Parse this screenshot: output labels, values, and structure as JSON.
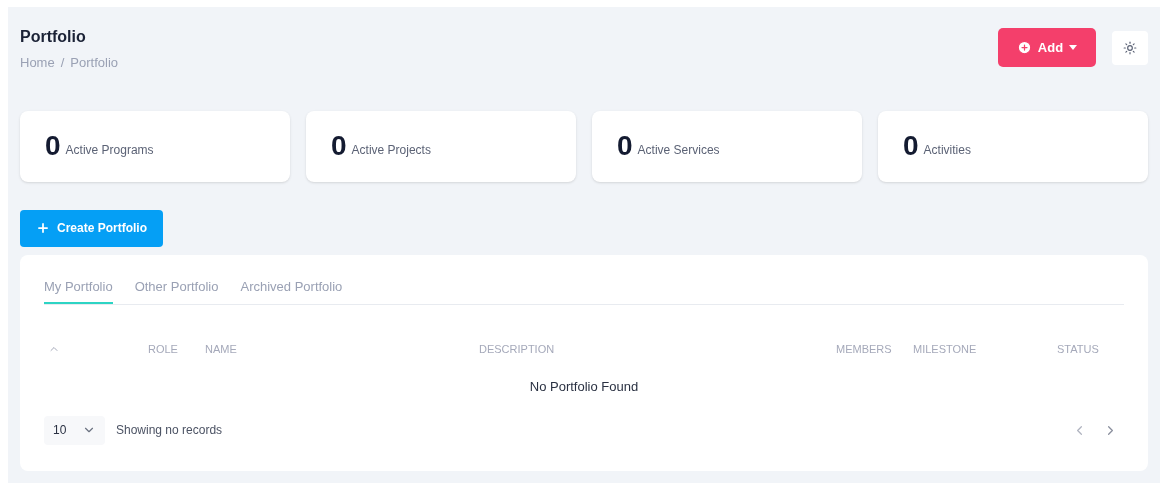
{
  "header": {
    "title": "Portfolio",
    "breadcrumb": [
      "Home",
      "Portfolio"
    ],
    "breadcrumb_separator": "/",
    "add_button": "Add"
  },
  "stats": [
    {
      "value": "0",
      "label": "Active Programs"
    },
    {
      "value": "0",
      "label": "Active Projects"
    },
    {
      "value": "0",
      "label": "Active Services"
    },
    {
      "value": "0",
      "label": "Activities"
    }
  ],
  "create_button": "Create Portfolio",
  "tabs": [
    {
      "label": "My Portfolio",
      "selected": true
    },
    {
      "label": "Other Portfolio",
      "selected": false
    },
    {
      "label": "Archived Portfolio",
      "selected": false
    }
  ],
  "table": {
    "columns": [
      "ROLE",
      "NAME",
      "DESCRIPTION",
      "MEMBERS",
      "MILESTONE",
      "STATUS"
    ],
    "empty_message": "No Portfolio Found"
  },
  "footer": {
    "page_size": "10",
    "record_info": "Showing no records"
  }
}
